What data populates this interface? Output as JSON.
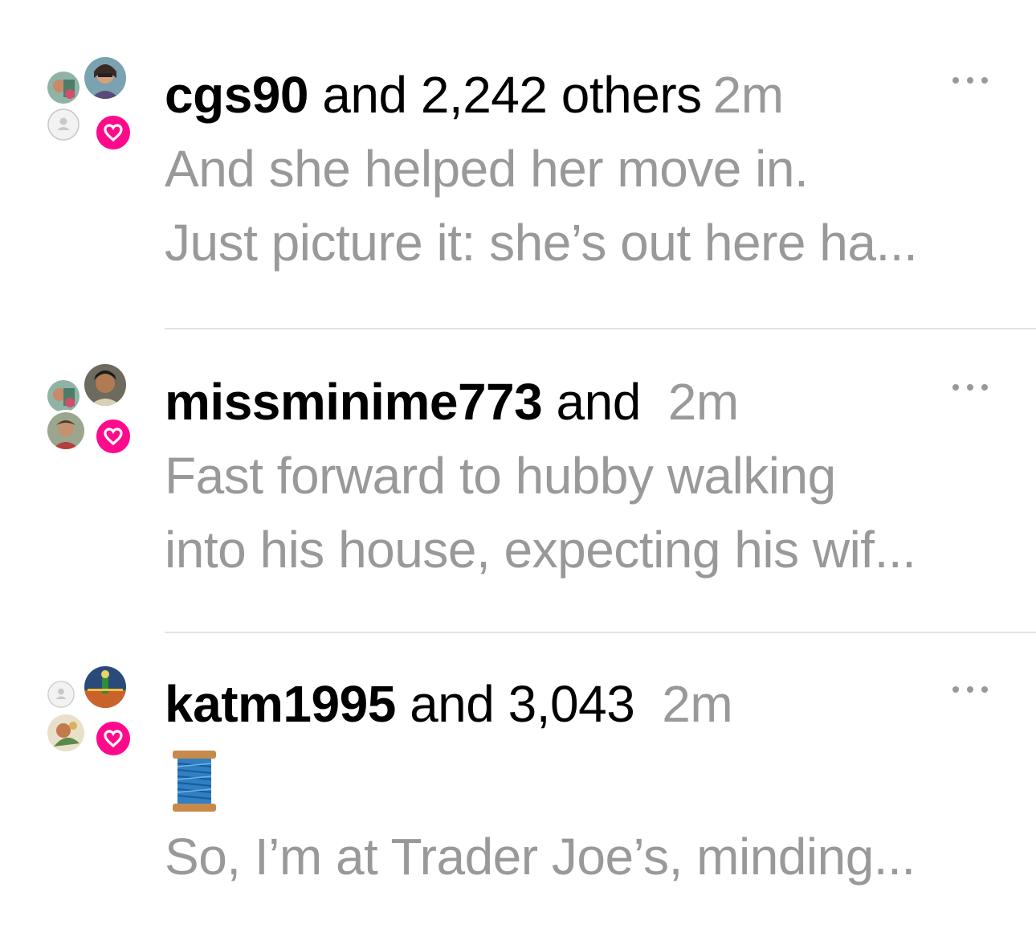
{
  "notifications": [
    {
      "username": "cgs90",
      "others": "and 2,242 others",
      "time": "2m",
      "lines": [
        "And she helped her move in.",
        "Just picture it: she’s out here ha..."
      ],
      "emoji": ""
    },
    {
      "username": "missminime773",
      "others": "and",
      "time": "2m",
      "lines": [
        "Fast forward to hubby walking",
        "into his house, expecting his wif..."
      ],
      "emoji": ""
    },
    {
      "username": "katm1995",
      "others": "and 3,043",
      "time": "2m",
      "lines": [
        "So, I’m at Trader Joe’s, minding..."
      ],
      "emoji": "spool-of-thread"
    }
  ],
  "colors": {
    "heart_badge": "#ff0a8c",
    "muted_text": "#999999",
    "divider": "#e3e3e3"
  }
}
